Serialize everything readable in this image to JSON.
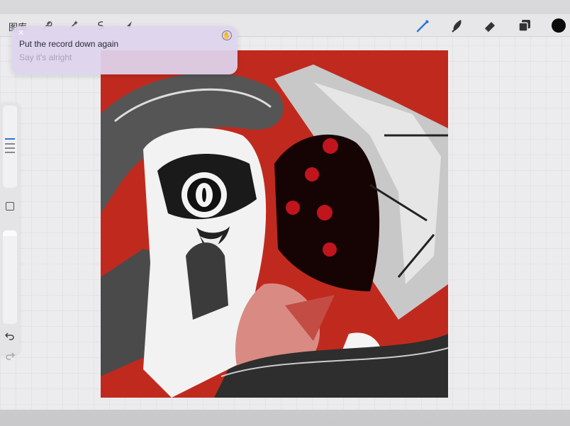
{
  "app": {
    "gallery_label": "图库"
  },
  "toolbar_left": [
    {
      "name": "wrench-icon",
      "glyph": "🔧"
    },
    {
      "name": "magic-wand-icon",
      "glyph": "✦"
    },
    {
      "name": "selection-icon",
      "glyph": "S"
    },
    {
      "name": "transform-arrow-icon",
      "glyph": "➤"
    }
  ],
  "toolbar_right": {
    "brush": "brush-icon",
    "smudge": "smudge-icon",
    "eraser": "eraser-icon",
    "layers": "layers-icon",
    "color_value": "#0b0b0b"
  },
  "toast": {
    "line1": "Put the record down again",
    "line2": "Say it's alright"
  },
  "colors": {
    "canvas_bg": "#c02a1e",
    "accent": "#2c74d6"
  }
}
